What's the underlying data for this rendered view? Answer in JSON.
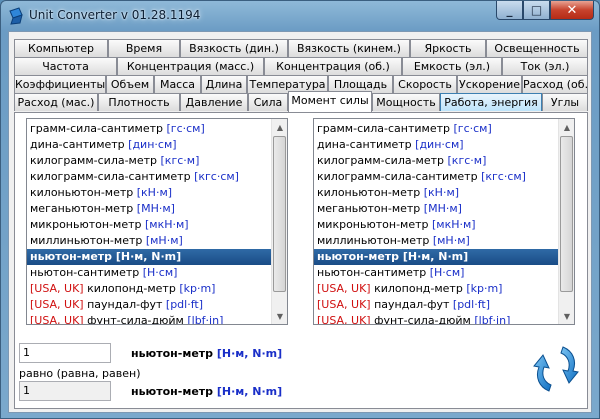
{
  "window": {
    "title": "Unit Converter v 01.28.1194",
    "minimize_label": "_",
    "maximize_label": "□",
    "close_label": "✕"
  },
  "tabs": {
    "row1": [
      "Компьютер",
      "Время",
      "Вязкость (дин.)",
      "Вязкость (кинем.)",
      "Яркость",
      "Освещенность"
    ],
    "row2": [
      "Частота",
      "Концентрация (масс.)",
      "Концентрация (об.)",
      "Емкость (эл.)",
      "Ток (эл.)"
    ],
    "row3": [
      "Коэффициенты",
      "Объем",
      "Масса",
      "Длина",
      "Температура",
      "Площадь",
      "Скорость",
      "Ускорение",
      "Расход (об.)"
    ],
    "row4": [
      "Расход (мас.)",
      "Плотность",
      "Давление",
      "Сила",
      "Момент силы",
      "Мощность",
      "Работа, энергия",
      "Углы"
    ],
    "active": "Момент силы",
    "hover": "Работа, энергия"
  },
  "units": [
    {
      "name": "грамм-сила-сантиметр ",
      "sym": "[гс·см]"
    },
    {
      "name": "дина-сантиметр ",
      "sym": "[дин·см]"
    },
    {
      "name": "килограмм-сила-метр ",
      "sym": "[кгс·м]"
    },
    {
      "name": "килограмм-сила-сантиметр ",
      "sym": "[кгс·см]"
    },
    {
      "name": "килоньютон-метр ",
      "sym": "[кН·м]"
    },
    {
      "name": "меганьютон-метр ",
      "sym": "[МН·м]"
    },
    {
      "name": "микроньютон-метр ",
      "sym": "[мкН·м]"
    },
    {
      "name": "миллиньютон-метр ",
      "sym": "[мН·м]"
    },
    {
      "name": "ньютон-метр ",
      "sym": "[Н·м, N·m]"
    },
    {
      "name": "ньютон-сантиметр ",
      "sym": "[Н·см]"
    },
    {
      "region": "[USA, UK]",
      "name": " килопонд-метр ",
      "sym": "[kp·m]"
    },
    {
      "region": "[USA, UK]",
      "name": " паундал-фут ",
      "sym": "[pdl·ft]"
    },
    {
      "region": "[USA, UK]",
      "name": " фунт-сила-дюйм ",
      "sym": "[lbf·in]"
    }
  ],
  "selected_index": 8,
  "from": {
    "value": "1",
    "unit_name": "ньютон-метр ",
    "unit_sym": "[Н·м, N·m]"
  },
  "equals_label": "равно (равна, равен)",
  "to": {
    "value": "1",
    "unit_name": "ньютон-метр ",
    "unit_sym": "[Н·м, N·m]"
  },
  "colors": {
    "accent_blue": "#1a2fc8",
    "selection": "#1a4c86",
    "region_red": "#d01010",
    "swap_arrows": "#1e88d8"
  }
}
